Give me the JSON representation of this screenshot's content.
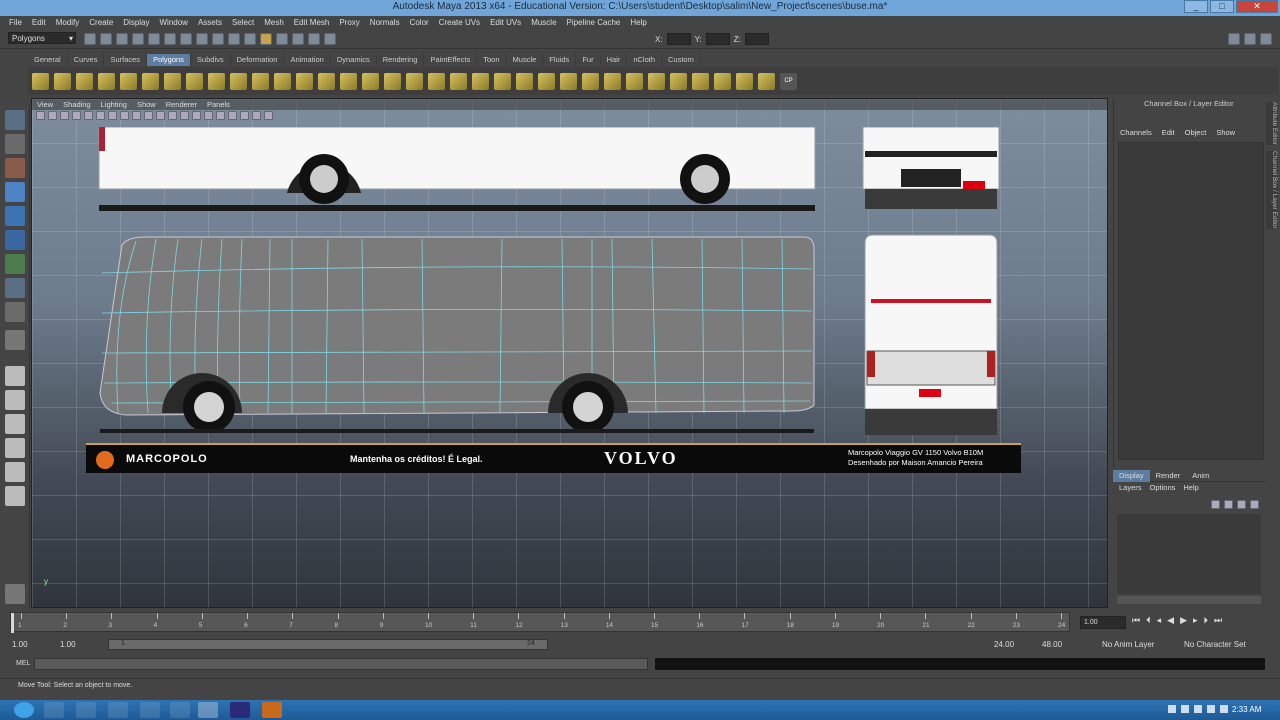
{
  "window": {
    "title": "Autodesk Maya 2013 x64 - Educational Version: C:\\Users\\student\\Desktop\\salim\\New_Project\\scenes\\buse.ma*"
  },
  "menubar": [
    "File",
    "Edit",
    "Modify",
    "Create",
    "Display",
    "Window",
    "Assets",
    "Select",
    "Mesh",
    "Edit Mesh",
    "Proxy",
    "Normals",
    "Color",
    "Create UVs",
    "Edit UVs",
    "Muscle",
    "Pipeline Cache",
    "Help"
  ],
  "statusline": {
    "mode_selector": "Polygons",
    "x_label": "X:",
    "y_label": "Y:",
    "z_label": "Z:"
  },
  "shelf_tabs": [
    "General",
    "Curves",
    "Surfaces",
    "Polygons",
    "Subdivs",
    "Deformation",
    "Animation",
    "Dynamics",
    "Rendering",
    "PaintEffects",
    "Toon",
    "Muscle",
    "Fluids",
    "Fur",
    "Hair",
    "nCloth",
    "Custom"
  ],
  "shelf_active": "Polygons",
  "viewport": {
    "menu": [
      "View",
      "Shading",
      "Lighting",
      "Show",
      "Renderer",
      "Panels"
    ],
    "banner": {
      "logo_text": "MARCOPOLO",
      "center_text": "Mantenha os créditos! É Legal.",
      "brand": "VOLVO",
      "credit_line1": "Marcopolo Viaggio GV 1150 Volvo B10M",
      "credit_line2": "Desenhado por Maison Amancio Pereira"
    }
  },
  "channel_box": {
    "title": "Channel Box / Layer Editor",
    "menu": [
      "Channels",
      "Edit",
      "Object",
      "Show"
    ],
    "side_tabs": [
      "Attribute Editor",
      "Channel Box / Layer Editor"
    ]
  },
  "layer_editor": {
    "tabs": [
      "Display",
      "Render",
      "Anim"
    ],
    "active_tab": "Display",
    "menu": [
      "Layers",
      "Options",
      "Help"
    ]
  },
  "time_slider": {
    "ticks": [
      "1",
      "2",
      "3",
      "4",
      "5",
      "6",
      "7",
      "8",
      "9",
      "10",
      "11",
      "12",
      "13",
      "14",
      "15",
      "16",
      "17",
      "18",
      "19",
      "20",
      "21",
      "22",
      "23",
      "24"
    ],
    "current_frame": "1.00"
  },
  "range_slider": {
    "start": "1.00",
    "start_inner": "1.00",
    "range_start_mark": "1",
    "range_end_mark": "24",
    "end_inner": "24.00",
    "end": "48.00",
    "anim_layer": "No Anim Layer",
    "character_set": "No Character Set"
  },
  "command_line": {
    "label": "MEL"
  },
  "help_line": {
    "text": "Move Tool: Select an object to move."
  },
  "taskbar": {
    "clock": "2:33 AM"
  }
}
